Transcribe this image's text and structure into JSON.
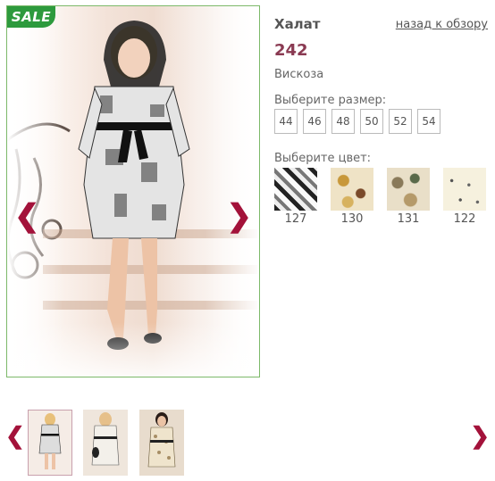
{
  "product": {
    "badge": "SALE",
    "title": "Халат",
    "back_link": "назад к обзору",
    "price": "242",
    "material": "Вискоза",
    "size_label": "Выберите размер:",
    "sizes": [
      "44",
      "46",
      "48",
      "50",
      "52",
      "54"
    ],
    "color_label": "Выберите цвет:",
    "colors": [
      {
        "code": "127"
      },
      {
        "code": "130"
      },
      {
        "code": "131"
      },
      {
        "code": "122"
      }
    ]
  },
  "gallery": {
    "prev_arrow": "❮",
    "next_arrow": "❯",
    "thumbs_prev": "❮",
    "thumbs_next": "❯"
  },
  "colors": {
    "accent": "#a3123a",
    "price": "#8a3a52",
    "sale_green": "#2d9a3d",
    "frame_border": "#7db96a"
  }
}
